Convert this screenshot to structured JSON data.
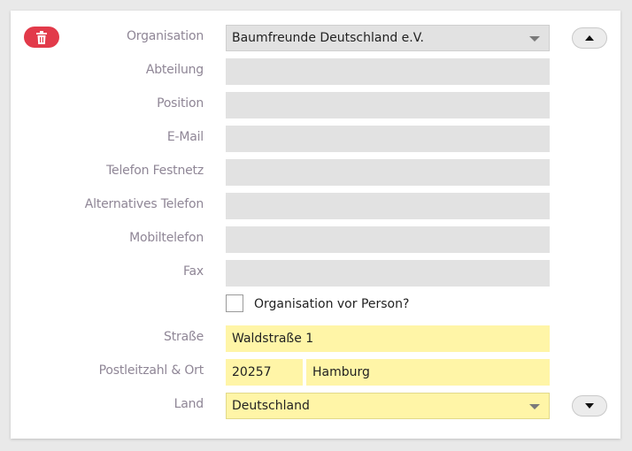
{
  "form": {
    "organisation": {
      "label": "Organisation",
      "value": "Baumfreunde Deutschland e.V."
    },
    "abteilung": {
      "label": "Abteilung",
      "value": ""
    },
    "position": {
      "label": "Position",
      "value": ""
    },
    "email": {
      "label": "E-Mail",
      "value": ""
    },
    "telefon_festnetz": {
      "label": "Telefon Festnetz",
      "value": ""
    },
    "alternatives_telefon": {
      "label": "Alternatives Telefon",
      "value": ""
    },
    "mobiltelefon": {
      "label": "Mobiltelefon",
      "value": ""
    },
    "fax": {
      "label": "Fax",
      "value": ""
    },
    "org_vor_person": {
      "label": "Organisation vor Person?",
      "checked": false
    },
    "strasse": {
      "label": "Straße",
      "value": "Waldstraße 1"
    },
    "plz_ort": {
      "label": "Postleitzahl & Ort",
      "plz": "20257",
      "ort": "Hamburg"
    },
    "land": {
      "label": "Land",
      "value": "Deutschland"
    }
  },
  "icons": {
    "delete": "trash-icon",
    "move_up": "caret-up-icon",
    "move_down": "caret-down-icon",
    "dropdown": "chevron-down-icon"
  },
  "colors": {
    "delete_button": "#e23a4a",
    "field_empty": "#e2e2e2",
    "field_filled": "#fff5a7",
    "label": "#8f8696"
  }
}
